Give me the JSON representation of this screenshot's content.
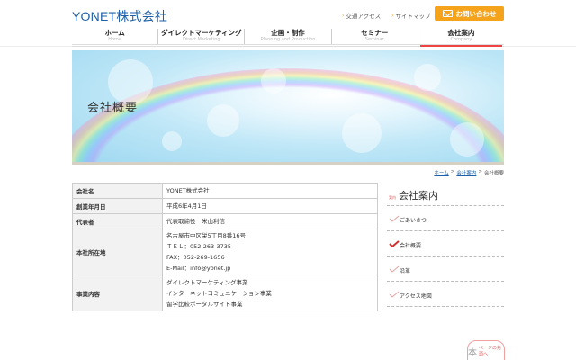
{
  "header": {
    "logo": "YONET株式会社",
    "links": [
      {
        "label": "交通アクセス"
      },
      {
        "label": "サイトマップ"
      }
    ],
    "contact_label": "お問い合わせ"
  },
  "nav": [
    {
      "jp": "ホーム",
      "en": "Home"
    },
    {
      "jp": "ダイレクトマーケティング",
      "en": "Direct Marketing"
    },
    {
      "jp": "企画・制作",
      "en": "Planning and Production"
    },
    {
      "jp": "セミナー",
      "en": "Seminar"
    },
    {
      "jp": "会社案内",
      "en": "Company"
    }
  ],
  "hero": {
    "title": "会社概要"
  },
  "breadcrumb": {
    "home": "ホーム",
    "company": "会社案内",
    "current": "会社概要",
    "sep": ">"
  },
  "table": [
    {
      "label": "会社名",
      "lines": [
        "YONET株式会社"
      ]
    },
    {
      "label": "創業年月日",
      "lines": [
        "平成6年4月1日"
      ]
    },
    {
      "label": "代表者",
      "lines": [
        "代表取締役　米山利信"
      ]
    },
    {
      "label": "本社所在地",
      "lines": [
        "名古屋市中区栄5丁目8番16号",
        "ＴＥＬ：052-263-3735",
        "FAX：052-269-1656",
        "E-Mail：info@yonet.jp"
      ]
    },
    {
      "label": "事業内容",
      "lines": [
        "ダイレクトマーケティング事業",
        "インターネットコミュニケーション事業",
        "留学比較ポータルサイト事業"
      ]
    }
  ],
  "sidebar": {
    "small": "案内",
    "title": "会社案内",
    "items": [
      {
        "label": "ごあいさつ"
      },
      {
        "label": "会社概要"
      },
      {
        "label": "沿革"
      },
      {
        "label": "アクセス地図"
      }
    ]
  },
  "pagetop": {
    "kanji": "本",
    "text": "ページの先頭へ"
  }
}
